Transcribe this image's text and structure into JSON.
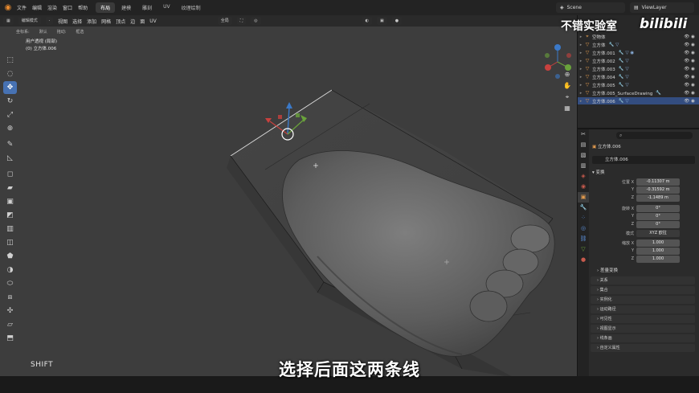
{
  "app": {
    "menu": [
      "文件",
      "编辑",
      "渲染",
      "窗口",
      "帮助"
    ],
    "workspaces": [
      "布局",
      "建模",
      "雕刻",
      "UV",
      "纹理绘制"
    ],
    "active_workspace": "布局",
    "scene": "Scene",
    "view_layer": "ViewLayer"
  },
  "viewport": {
    "mode": "编辑模式",
    "header_items": [
      "视图",
      "选择",
      "添加",
      "网格",
      "顶点",
      "边",
      "面",
      "UV"
    ],
    "transform_orientation": "全局",
    "sub_items": [
      "坐标系:",
      "默认",
      "拖动:",
      "框选"
    ],
    "view_name": "用户透视 (局部)",
    "object_label": "(0) 立方体.006",
    "shift_hint": "SHIFT",
    "subtitle": "选择后面这两条线"
  },
  "watermark": {
    "channel": "不错实验室",
    "site": "bilibili"
  },
  "outliner": {
    "items": [
      {
        "name": "空物体",
        "mods": ""
      },
      {
        "name": "立方体",
        "mods": "🔧 ▽"
      },
      {
        "name": "立方体.001",
        "mods": "🔧 ▽ ◉"
      },
      {
        "name": "立方体.002",
        "mods": "🔧 ▽"
      },
      {
        "name": "立方体.003",
        "mods": "🔧 ▽"
      },
      {
        "name": "立方体.004",
        "mods": "🔧 ▽"
      },
      {
        "name": "立方体.005",
        "mods": "🔧 ▽"
      },
      {
        "name": "立方体.005_SurfaceDrawing",
        "mods": "🔧"
      },
      {
        "name": "立方体.006",
        "mods": "🔧 ▽"
      }
    ]
  },
  "properties": {
    "object_name": "立方体.006",
    "transform_section": "变换",
    "location_label": "位置 X",
    "location": [
      "-0.11307 m",
      "-0.31592 m",
      "-1.1489 m"
    ],
    "rotation_label": "旋转 X",
    "rotation": [
      "0°",
      "0°",
      "0°"
    ],
    "mode_label": "模式",
    "mode_value": "XYZ 欧拉",
    "scale_label": "缩放 X",
    "scale": [
      "1.000",
      "1.000",
      "1.000"
    ],
    "axis_y": "Y",
    "axis_z": "Z",
    "delta_section": "差量变换",
    "sections": [
      "关系",
      "集合",
      "实例化",
      "运动路径",
      "可见性",
      "视图显示",
      "线条画",
      "自定义属性"
    ]
  }
}
